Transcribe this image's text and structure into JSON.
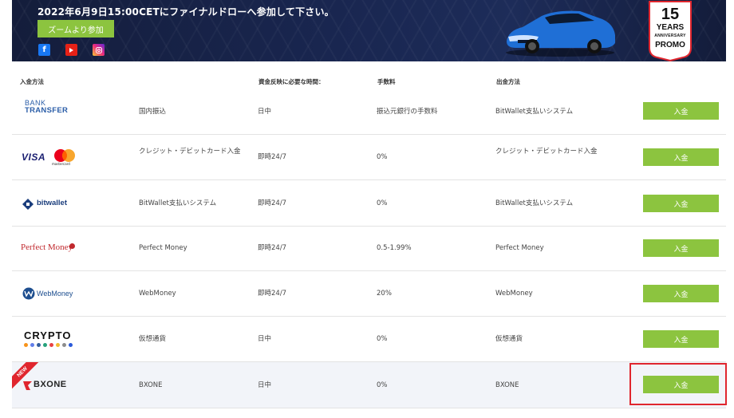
{
  "banner": {
    "title": "2022年6月9日15:00CETにファイナルドローへ参加して下さい。",
    "zoom_button": "ズームより参加",
    "social": [
      "facebook-icon",
      "youtube-icon",
      "instagram-icon"
    ],
    "promo": {
      "number": "15",
      "years": "YEARS",
      "anniversary": "ANNIVERSARY",
      "promo": "PROMO"
    }
  },
  "table": {
    "headers": {
      "method": "入金方法",
      "time": "資金反映に必要な時間：",
      "fee": "手数料",
      "withdraw": "出金方法"
    },
    "rows": [
      {
        "logo": "bank-transfer",
        "logo_text_1": "BANK",
        "logo_text_2": "TRANSFER",
        "name": "国内振込",
        "time": "日中",
        "fee": "振込元銀行の手数料",
        "withdraw": "BitWallet支払いシステム",
        "button": "入金"
      },
      {
        "logo": "visa-mastercard",
        "logo_text_1": "VISA",
        "logo_text_2": "mastercard",
        "name": "クレジット・デビットカード入金",
        "time": "即時24/7",
        "fee": "0%",
        "withdraw": "クレジット・デビットカード入金",
        "button": "入金"
      },
      {
        "logo": "bitwallet",
        "logo_text_1": "bitwallet",
        "name": "BitWallet支払いシステム",
        "time": "即時24/7",
        "fee": "0%",
        "withdraw": "BitWallet支払いシステム",
        "button": "入金"
      },
      {
        "logo": "perfect-money",
        "logo_text_1": "Perfect Money",
        "name": "Perfect Money",
        "time": "即時24/7",
        "fee": "0.5-1.99%",
        "withdraw": "Perfect Money",
        "button": "入金"
      },
      {
        "logo": "webmoney",
        "logo_text_1": "WebMoney",
        "name": "WebMoney",
        "time": "即時24/7",
        "fee": "20%",
        "withdraw": "WebMoney",
        "button": "入金"
      },
      {
        "logo": "crypto",
        "logo_text_1": "CRYPTO",
        "name": "仮想通貨",
        "time": "日中",
        "fee": "0%",
        "withdraw": "仮想通貨",
        "button": "入金"
      },
      {
        "logo": "bxone",
        "logo_text_1": "BXONE",
        "badge": "NEW",
        "name": "BXONE",
        "time": "日中",
        "fee": "0%",
        "withdraw": "BXONE",
        "button": "入金"
      }
    ]
  },
  "colors": {
    "banner_bg": "#192650",
    "accent_green": "#8cc43f",
    "highlight_red": "#e0262e",
    "row_highlight": "#f2f4f9"
  }
}
